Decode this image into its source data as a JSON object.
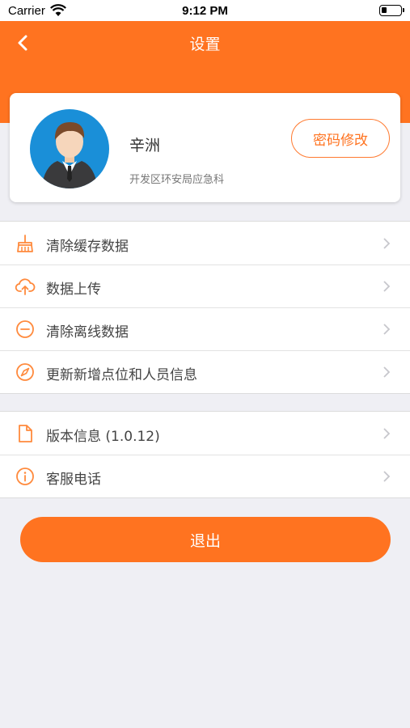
{
  "status_bar": {
    "carrier": "Carrier",
    "time": "9:12 PM"
  },
  "header": {
    "title": "设置",
    "back_icon": "chevron-left-icon"
  },
  "profile": {
    "name": "辛洲",
    "department": "开发区环安局应急科",
    "password_button": "密码修改"
  },
  "group1": [
    {
      "label": "清除缓存数据",
      "icon": "broom-icon"
    },
    {
      "label": "数据上传",
      "icon": "cloud-upload-icon"
    },
    {
      "label": "清除离线数据",
      "icon": "minus-circle-icon"
    },
    {
      "label": "更新新增点位和人员信息",
      "icon": "compass-icon"
    }
  ],
  "group2": [
    {
      "label": "版本信息 (1.0.12)",
      "icon": "document-icon"
    },
    {
      "label": "客服电话",
      "icon": "info-circle-icon"
    }
  ],
  "logout_label": "退出",
  "colors": {
    "accent": "#ff7320",
    "background": "#efeff4"
  }
}
